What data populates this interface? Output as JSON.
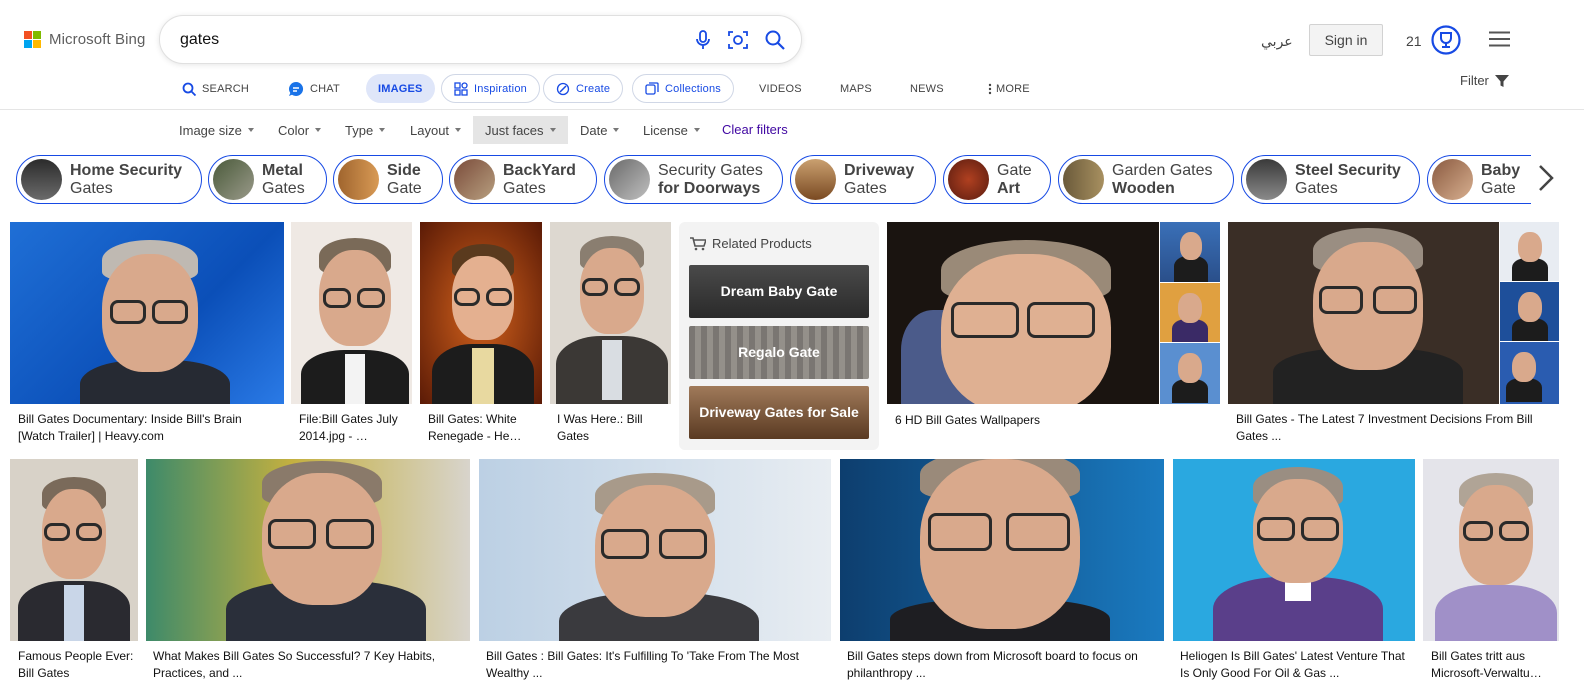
{
  "header": {
    "logo_text": "Microsoft Bing",
    "search_query": "gates",
    "language_link": "عربي",
    "signin_label": "Sign in",
    "rewards_count": "21"
  },
  "nav": {
    "search": "SEARCH",
    "chat": "CHAT",
    "images": "IMAGES",
    "inspiration": "Inspiration",
    "create": "Create",
    "collections": "Collections",
    "videos": "VIDEOS",
    "maps": "MAPS",
    "news": "NEWS",
    "more": "MORE",
    "filter": "Filter"
  },
  "filters": {
    "image_size": "Image size",
    "color": "Color",
    "type": "Type",
    "layout": "Layout",
    "just_faces": "Just faces",
    "date": "Date",
    "license": "License",
    "clear": "Clear filters"
  },
  "chips": [
    {
      "a": "Home Security",
      "b": "Gates",
      "bold_first": true
    },
    {
      "a": "Metal",
      "b": "Gates",
      "bold_first": true
    },
    {
      "a": "Side",
      "b": "Gate",
      "bold_first": true
    },
    {
      "a": "BackYard",
      "b": "Gates",
      "bold_first": true
    },
    {
      "a": "Security Gates",
      "b": "for Doorways",
      "bold_first": false
    },
    {
      "a": "Driveway",
      "b": "Gates",
      "bold_first": true
    },
    {
      "a": "Gate",
      "b": "Art",
      "bold_first": false
    },
    {
      "a": "Garden Gates",
      "b": "Wooden",
      "bold_first": false
    },
    {
      "a": "Steel Security",
      "b": "Gates",
      "bold_first": true
    },
    {
      "a": "Baby",
      "b": "Gate",
      "bold_first": true
    }
  ],
  "related": {
    "title": "Related Products",
    "products": [
      "Dream Baby Gate",
      "Regalo Gate",
      "Driveway Gates for Sale"
    ]
  },
  "results": {
    "row1": [
      "Bill Gates Documentary: Inside Bill's Brain [Watch Trailer] | Heavy.com",
      "File:Bill Gates July 2014.jpg - …",
      "Bill Gates: White Renegade - He…",
      "I Was Here.: Bill Gates",
      "6 HD Bill Gates Wallpapers",
      "Bill Gates - The Latest 7 Investment Decisions From Bill Gates ..."
    ],
    "row2": [
      "Famous People Ever: Bill Gates",
      "What Makes Bill Gates So Successful? 7 Key Habits, Practices, and ...",
      "Bill Gates : Bill Gates: It's Fulfilling To 'Take From The Most Wealthy ...",
      "Bill Gates steps down from Microsoft board to focus on philanthropy ...",
      "Heliogen Is Bill Gates' Latest Venture That Is Only Good For Oil & Gas ...",
      "Bill Gates tritt aus Microsoft-Verwaltu…"
    ]
  }
}
